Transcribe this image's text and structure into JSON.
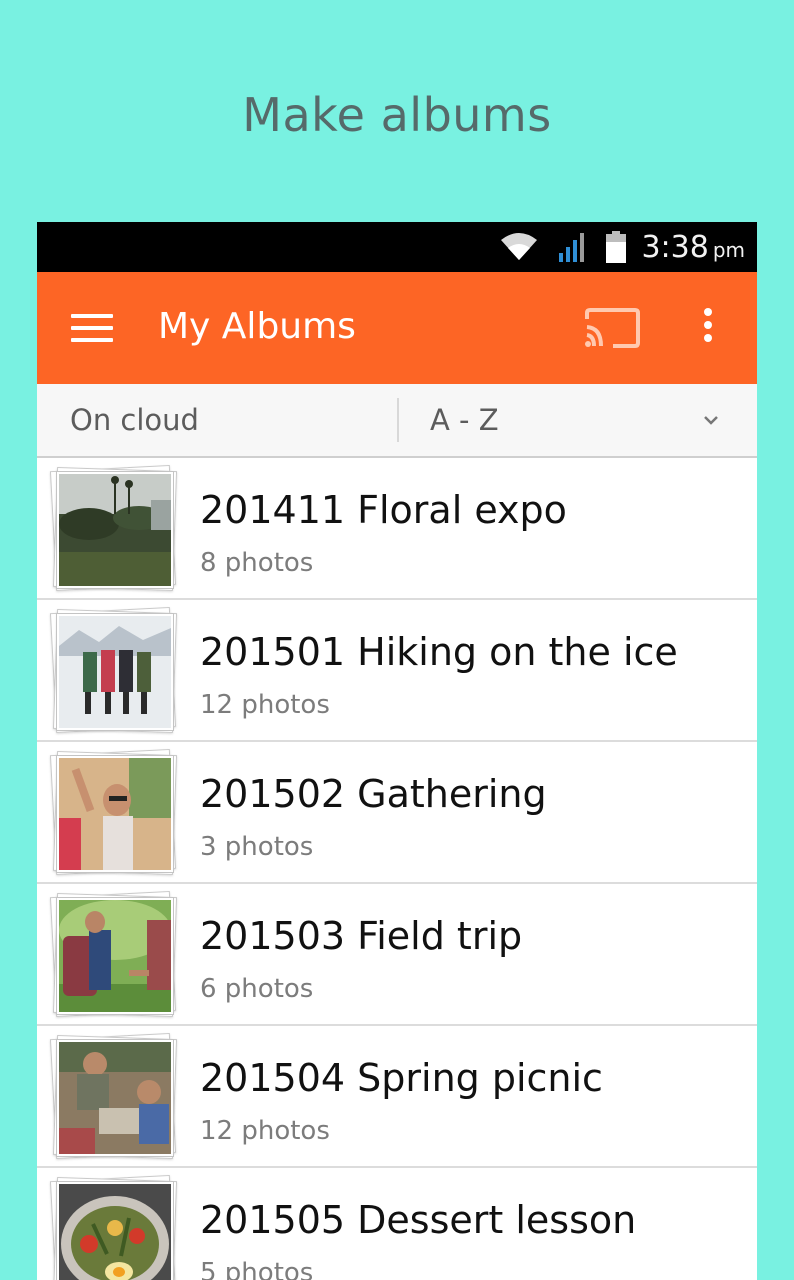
{
  "headline": "Make albums",
  "status_bar": {
    "time": "3:38",
    "ampm": "pm",
    "icons": [
      "wifi-icon",
      "signal-icon",
      "battery-icon"
    ]
  },
  "app_bar": {
    "title": "My Albums",
    "color": "#fd6525",
    "icons": [
      "menu-icon",
      "cast-icon",
      "more-vert-icon"
    ]
  },
  "filter": {
    "source": "On cloud",
    "sort": "A - Z"
  },
  "albums": [
    {
      "name": "201411 Floral expo",
      "count": "8 photos"
    },
    {
      "name": "201501 Hiking on the ice",
      "count": "12 photos"
    },
    {
      "name": "201502 Gathering",
      "count": "3 photos"
    },
    {
      "name": "201503 Field trip",
      "count": "6 photos"
    },
    {
      "name": "201504 Spring picnic",
      "count": "12 photos"
    },
    {
      "name": "201505 Dessert lesson",
      "count": "5 photos"
    }
  ]
}
